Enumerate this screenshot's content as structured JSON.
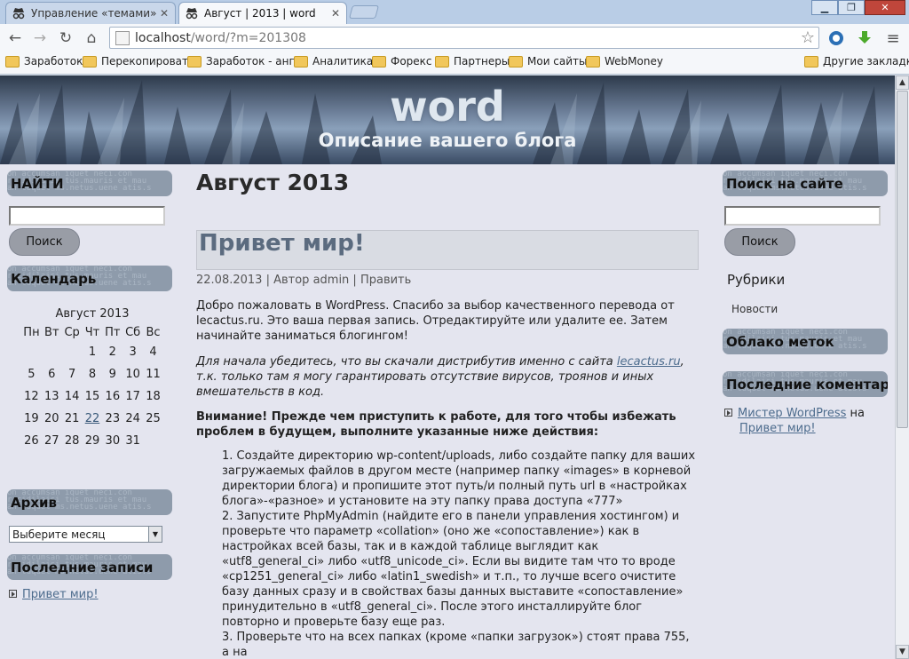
{
  "browser": {
    "tabs": [
      {
        "title": "Управление «темами» ‹ wor"
      },
      {
        "title": "Август | 2013 | word"
      }
    ],
    "url_host": "localhost",
    "url_path": "/word/?m=201308",
    "bookmarks": [
      "Заработок",
      "Перекопировать",
      "Заработок - англ",
      "Аналитика",
      "Форекс",
      "Партнеры",
      "Мои сайты",
      "WebMoney"
    ],
    "other_bookmarks": "Другие закладки"
  },
  "header": {
    "title": "word",
    "description": "Описание вашего блога"
  },
  "left": {
    "search_title": "НАЙТИ",
    "search_button": "Поиск",
    "calendar_title": "Календарь",
    "calendar": {
      "caption": "Август 2013",
      "days": [
        "Пн",
        "Вт",
        "Ср",
        "Чт",
        "Пт",
        "Сб",
        "Вс"
      ],
      "rows": [
        [
          "",
          "",
          "",
          "1",
          "2",
          "3",
          "4"
        ],
        [
          "5",
          "6",
          "7",
          "8",
          "9",
          "10",
          "11"
        ],
        [
          "12",
          "13",
          "14",
          "15",
          "16",
          "17",
          "18"
        ],
        [
          "19",
          "20",
          "21",
          "22",
          "23",
          "24",
          "25"
        ],
        [
          "26",
          "27",
          "28",
          "29",
          "30",
          "31",
          ""
        ]
      ],
      "linked_day": "22"
    },
    "archive_title": "Архив",
    "archive_select": "Выберите месяц",
    "recent_title": "Последние записи",
    "recent_link": "Привет мир!"
  },
  "main": {
    "archive_heading": "Август 2013",
    "post_title": "Привет мир!",
    "meta_date": "22.08.2013",
    "meta_sep1": " | Автор ",
    "meta_author": "admin",
    "meta_sep2": " | ",
    "meta_edit": "Править",
    "p1": "Добро пожаловать в WordPress. Спасибо за выбор качественного перевода от lecactus.ru. Это ваша первая запись. Отредактируйте или удалите ее. Затем начинайте заниматься блогингом!",
    "p2_a": "Для начала убедитесь, что вы скачали дистрибутив именно с сайта ",
    "p2_link": "lecactus.ru",
    "p2_b": ", т.к. только там я могу гарантировать отсутствие вирусов, троянов и иных вмешательств в код.",
    "p3": "Внимание! Прежде чем приступить к работе, для того чтобы избежать проблем в будущем, выполните указанные ниже действия:",
    "list1": "1. Создайте директорию wp-content/uploads, либо создайте папку для ваших загружаемых файлов в другом месте (например папку «images» в корневой директории блога) и пропишите этот путь/и полный путь url в «настройках блога»-«разное» и установите на эту папку права доступа «777»",
    "list2": "2. Запустите PhpMyAdmin (найдите его в панели управления хостингом) и проверьте что параметр «collation» (оно же «сопоставление») как в настройках всей базы, так и в каждой таблице выглядит как «utf8_general_ci» либо «utf8_unicode_ci». Если вы видите там что то вроде «cp1251_general_ci» либо «latin1_swedish» и т.п., то лучше всего очистите базу данных сразу и в свойствах базы данных выставите «сопоставление» принудительно в «utf8_general_ci». После этого инсталлируйте блог повторно и проверьте базу еще раз.",
    "list3": "3. Проверьте что на всех папках (кроме «папки загрузок») стоят права 755, а на"
  },
  "right": {
    "search_title": "Поиск на сайте",
    "search_button": "Поиск",
    "categories_title": "Рубрики",
    "category": "Новости",
    "tags_title": "Облако меток",
    "comments_title": "Последние коментарии",
    "comment_author": "Мистер WordPress",
    "comment_on": " на",
    "comment_post": "Привет мир!"
  },
  "colors": {
    "page_bg": "#e4e5ef",
    "widget_bg": "#8e9bab",
    "link": "#4d6c8d",
    "post_title": "#5b6b7f"
  }
}
